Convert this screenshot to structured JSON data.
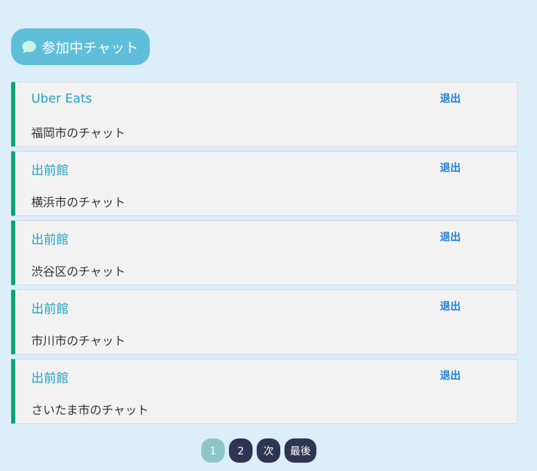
{
  "header": {
    "title": "参加中チャット",
    "icon": "chat-bubble-icon"
  },
  "chats": [
    {
      "service": "Uber Eats",
      "room": "福岡市のチャット",
      "leave_label": "退出"
    },
    {
      "service": "出前館",
      "room": "横浜市のチャット",
      "leave_label": "退出"
    },
    {
      "service": "出前館",
      "room": "渋谷区のチャット",
      "leave_label": "退出"
    },
    {
      "service": "出前館",
      "room": "市川市のチャット",
      "leave_label": "退出"
    },
    {
      "service": "出前館",
      "room": "さいたま市のチャット",
      "leave_label": "退出"
    }
  ],
  "pagination": {
    "current": "1",
    "page2": "2",
    "next_label": "次",
    "last_label": "最後"
  },
  "colors": {
    "background": "#dceefa",
    "header_pill": "#5fbfdb",
    "accent_border": "#0aa573",
    "service_text": "#1fa3c3",
    "leave_link": "#1f7fd8",
    "pager_button": "#2e3452",
    "pager_active": "#8ec5c8"
  }
}
